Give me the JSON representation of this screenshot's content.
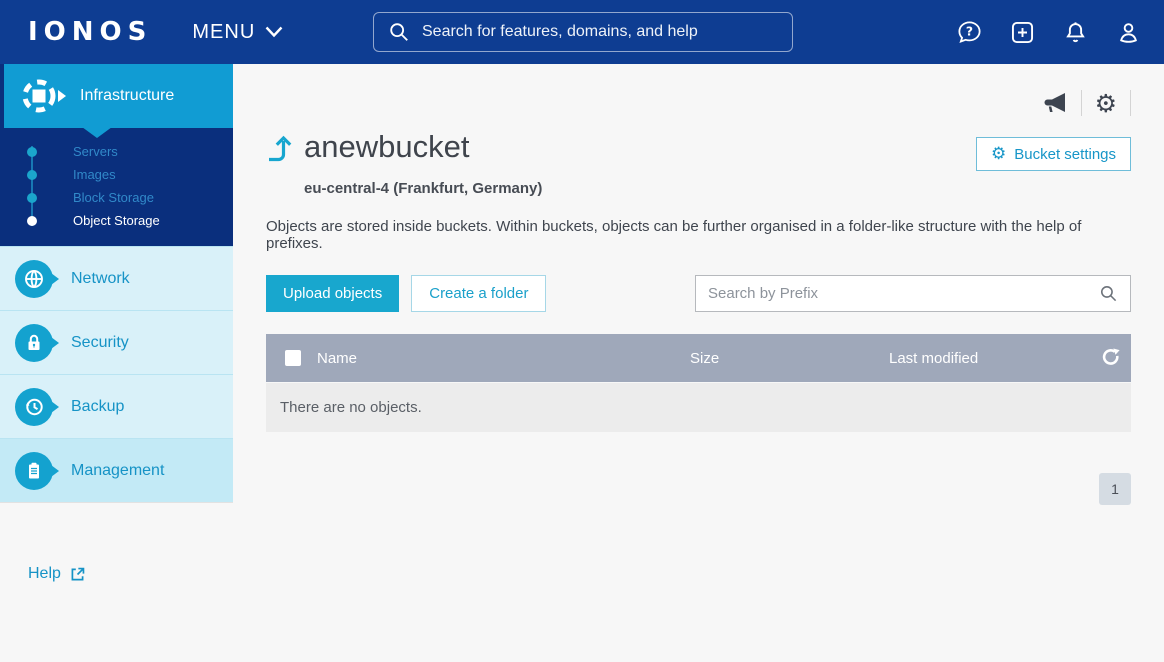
{
  "topbar": {
    "logo": "IONOS",
    "menu_label": "MENU",
    "search_placeholder": "Search for features, domains, and help"
  },
  "sidebar": {
    "sections": [
      {
        "label": "Infrastructure"
      },
      {
        "label": "Network"
      },
      {
        "label": "Security"
      },
      {
        "label": "Backup"
      },
      {
        "label": "Management"
      }
    ],
    "submenu": [
      {
        "label": "Servers"
      },
      {
        "label": "Images"
      },
      {
        "label": "Block Storage"
      },
      {
        "label": "Object Storage"
      }
    ],
    "help_label": "Help"
  },
  "content": {
    "title": "anewbucket",
    "region": "eu-central-4 (Frankfurt, Germany)",
    "description": "Objects are stored inside buckets. Within buckets, objects can be further organised in a folder-like structure with the help of prefixes.",
    "bucket_settings_label": "Bucket settings",
    "upload_label": "Upload objects",
    "create_folder_label": "Create a folder",
    "prefix_search_placeholder": "Search by Prefix",
    "table": {
      "columns": [
        "Name",
        "Size",
        "Last modified"
      ],
      "empty_message": "There are no objects."
    },
    "pagination": {
      "current_page": "1"
    }
  },
  "colors": {
    "topbar_blue": "#0e3d92",
    "submenu_navy": "#0a2f7d",
    "accent_teal": "#18a7ce",
    "sidebar_light": "#d9f1f9",
    "table_header": "#9fa8ba"
  }
}
